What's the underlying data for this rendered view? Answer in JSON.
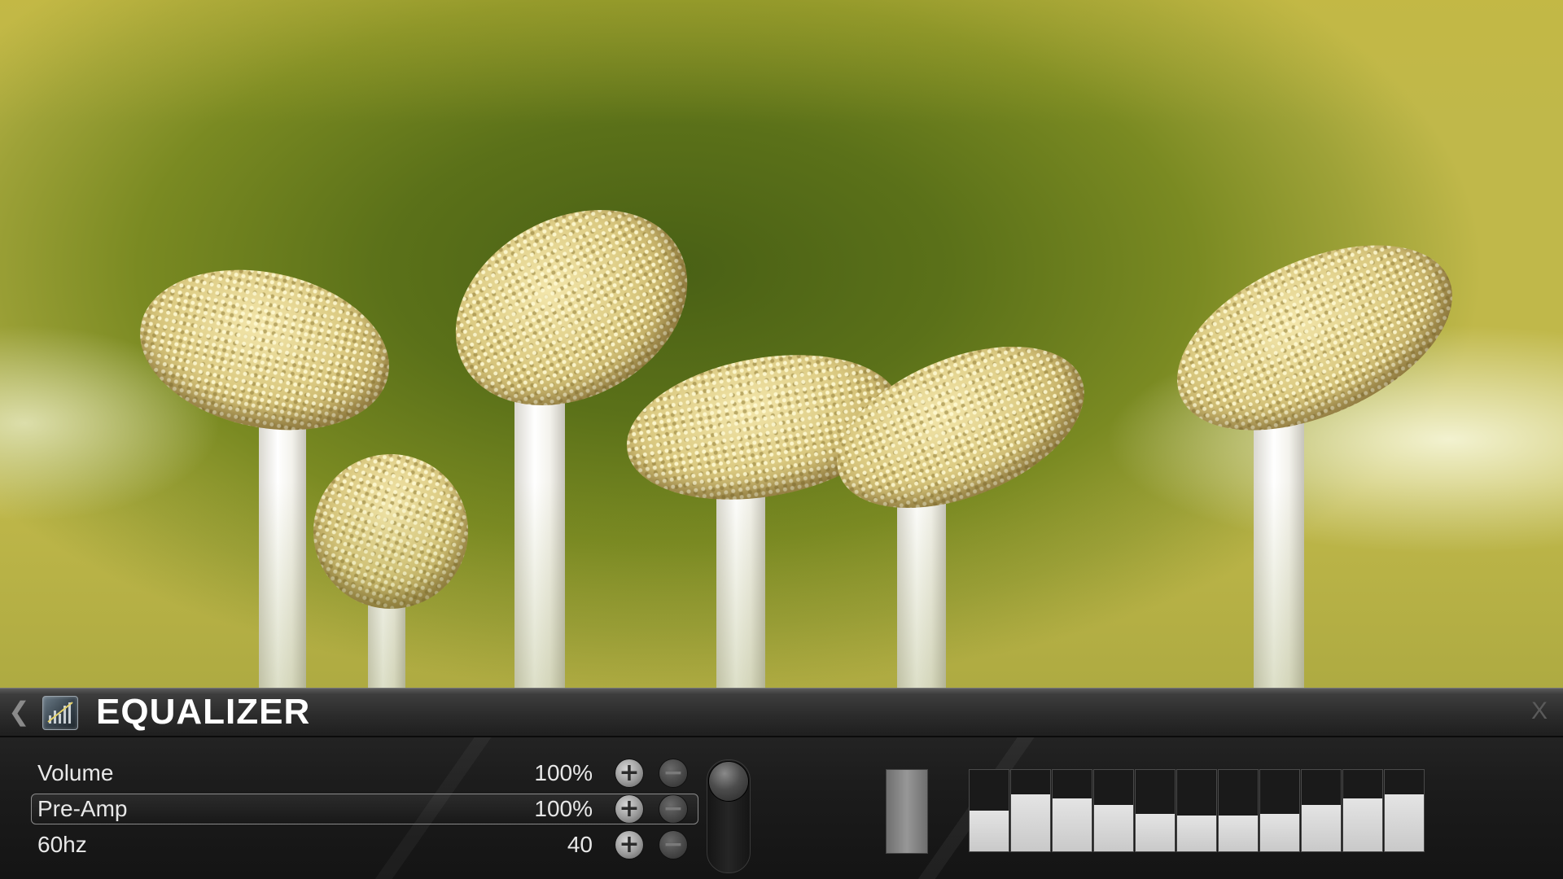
{
  "header": {
    "title": "EQUALIZER",
    "close_label": "X"
  },
  "icons": {
    "back": "chevron-left-icon",
    "logo": "equalizer-icon",
    "close": "close-icon",
    "increment": "plus-icon",
    "decrement": "minus-icon"
  },
  "rows": [
    {
      "label": "Volume",
      "value": "100%",
      "selected": false
    },
    {
      "label": "Pre-Amp",
      "value": "100%",
      "selected": true
    },
    {
      "label": "60hz",
      "value": "40",
      "selected": false
    }
  ],
  "meters": {
    "preamp_level": 1.0,
    "bands": [
      0.5,
      0.7,
      0.65,
      0.57,
      0.46,
      0.44,
      0.44,
      0.46,
      0.57,
      0.65,
      0.7
    ]
  },
  "colors": {
    "panel": "#1c1c1c",
    "text": "#e8e8e8",
    "meter_fill": "#d6d6d6"
  }
}
